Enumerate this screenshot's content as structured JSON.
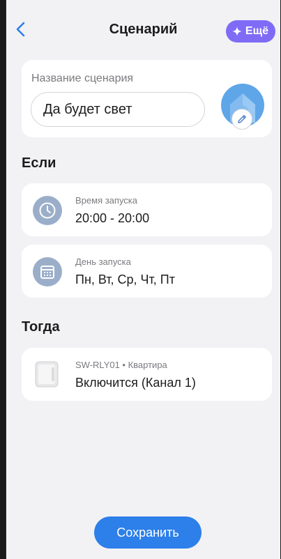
{
  "header": {
    "title": "Сценарий",
    "more_label": "Ещё",
    "back_icon": "chevron-left-icon",
    "more_icon": "sparkle-icon"
  },
  "scenario": {
    "name_label": "Название сценария",
    "name_value": "Да будет свет",
    "avatar_icon": "house-icon",
    "edit_icon": "pencil-icon"
  },
  "if_section": {
    "title": "Если",
    "conditions": [
      {
        "label": "Время запуска",
        "value": "20:00 - 20:00",
        "icon": "clock-icon"
      },
      {
        "label": "День запуска",
        "value": "Пн, Вт, Ср, Чт, Пт",
        "icon": "calendar-icon"
      }
    ]
  },
  "then_section": {
    "title": "Тогда",
    "actions": [
      {
        "device": "SW-RLY01 • Квартира",
        "action": "Включится (Канал 1)",
        "icon": "relay-device-icon"
      }
    ]
  },
  "footer": {
    "save_label": "Сохранить"
  },
  "colors": {
    "accent": "#2d7fea",
    "more_button": "#7e6cf6",
    "avatar": "#5fa6e8",
    "icon_circle": "#9baec9",
    "background": "#f2f2f4"
  }
}
